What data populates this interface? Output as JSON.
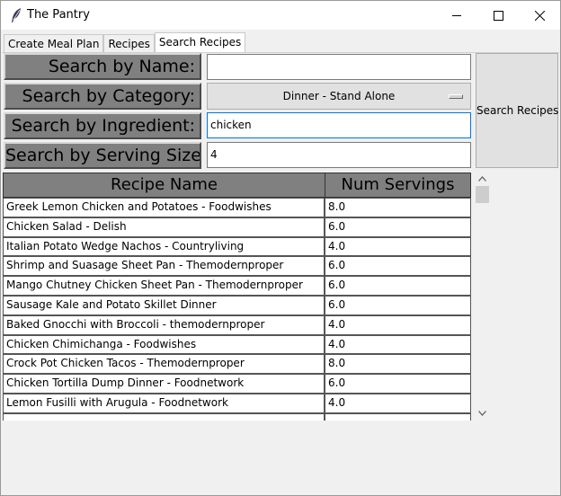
{
  "window": {
    "title": "The Pantry"
  },
  "tabs": [
    {
      "label": "Create Meal Plan",
      "active": false
    },
    {
      "label": "Recipes",
      "active": false
    },
    {
      "label": "Search Recipes",
      "active": true
    }
  ],
  "search": {
    "name_label": "Search by Name:",
    "name_value": "",
    "category_label": "Search by Category:",
    "category_value": "Dinner - Stand Alone",
    "ingredient_label": "Search by Ingredient:",
    "ingredient_value": "chicken",
    "serving_label": "Search by Serving Size:",
    "serving_value": "4",
    "button_label": "Search Recipes"
  },
  "table": {
    "columns": [
      "Recipe Name",
      "Num Servings"
    ],
    "rows": [
      {
        "name": "Greek Lemon Chicken and Potatoes - Foodwishes",
        "servings": "8.0"
      },
      {
        "name": "Chicken Salad - Delish",
        "servings": "6.0"
      },
      {
        "name": "Italian Potato Wedge Nachos - Countryliving",
        "servings": "4.0"
      },
      {
        "name": "Shrimp and Suasage Sheet Pan - Themodernproper",
        "servings": "6.0"
      },
      {
        "name": "Mango Chutney Chicken Sheet Pan - Themodernproper",
        "servings": "6.0"
      },
      {
        "name": "Sausage Kale and Potato Skillet Dinner",
        "servings": "6.0"
      },
      {
        "name": "Baked Gnocchi with Broccoli - themodernproper",
        "servings": "4.0"
      },
      {
        "name": "Chicken Chimichanga - Foodwishes",
        "servings": "4.0"
      },
      {
        "name": "Crock Pot Chicken Tacos - Themodernproper",
        "servings": "8.0"
      },
      {
        "name": "Chicken Tortilla Dump Dinner - Foodnetwork",
        "servings": "6.0"
      },
      {
        "name": "Lemon Fusilli with Arugula - Foodnetwork",
        "servings": "4.0"
      },
      {
        "name": "",
        "servings": ""
      }
    ]
  },
  "colors": {
    "label_bg": "#808080",
    "focus_border": "#0078d7"
  }
}
